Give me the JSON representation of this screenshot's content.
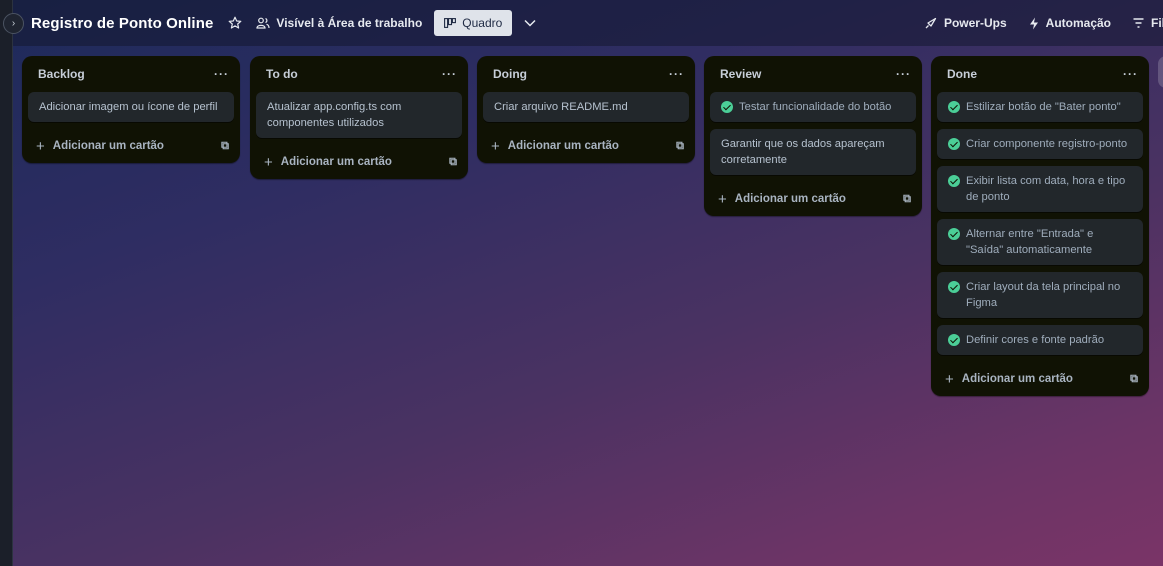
{
  "board": {
    "title": "Registro de Ponto Online",
    "visibility_label": "Visível à Área de trabalho",
    "view_label": "Quadro"
  },
  "topbar": {
    "powerups_label": "Power-Ups",
    "automation_label": "Automação",
    "filter_label": "Fil"
  },
  "lists": [
    {
      "title": "Backlog",
      "menu": "···",
      "cards": [
        {
          "text": "Adicionar imagem ou ícone de perfil",
          "done": false
        }
      ],
      "add_label": "Adicionar um cartão"
    },
    {
      "title": "To do",
      "menu": "···",
      "cards": [
        {
          "text": "Atualizar app.config.ts com componentes utilizados",
          "done": false
        }
      ],
      "add_label": "Adicionar um cartão"
    },
    {
      "title": "Doing",
      "menu": "···",
      "cards": [
        {
          "text": "Criar arquivo README.md",
          "done": false
        }
      ],
      "add_label": "Adicionar um cartão"
    },
    {
      "title": "Review",
      "menu": "···",
      "cards": [
        {
          "text": "Testar funcionalidade do botão",
          "done": true
        },
        {
          "text": "Garantir que os dados apareçam corretamente",
          "done": false
        }
      ],
      "add_label": "Adicionar um cartão"
    },
    {
      "title": "Done",
      "menu": "···",
      "cards": [
        {
          "text": "Estilizar botão de \"Bater ponto\"",
          "done": true
        },
        {
          "text": "Criar componente registro-ponto",
          "done": true
        },
        {
          "text": "Exibir lista com data, hora e tipo de ponto",
          "done": true
        },
        {
          "text": "Alternar entre \"Entrada\" e \"Saída\" automaticamente",
          "done": true
        },
        {
          "text": "Criar layout da tela principal no Figma",
          "done": true
        },
        {
          "text": "Definir cores e fonte padrão",
          "done": true
        }
      ],
      "add_label": "Adicionar um cartão"
    }
  ],
  "colors": {
    "list_bg": "#101204",
    "card_bg": "#22272b",
    "done_check": "#4bce97"
  }
}
